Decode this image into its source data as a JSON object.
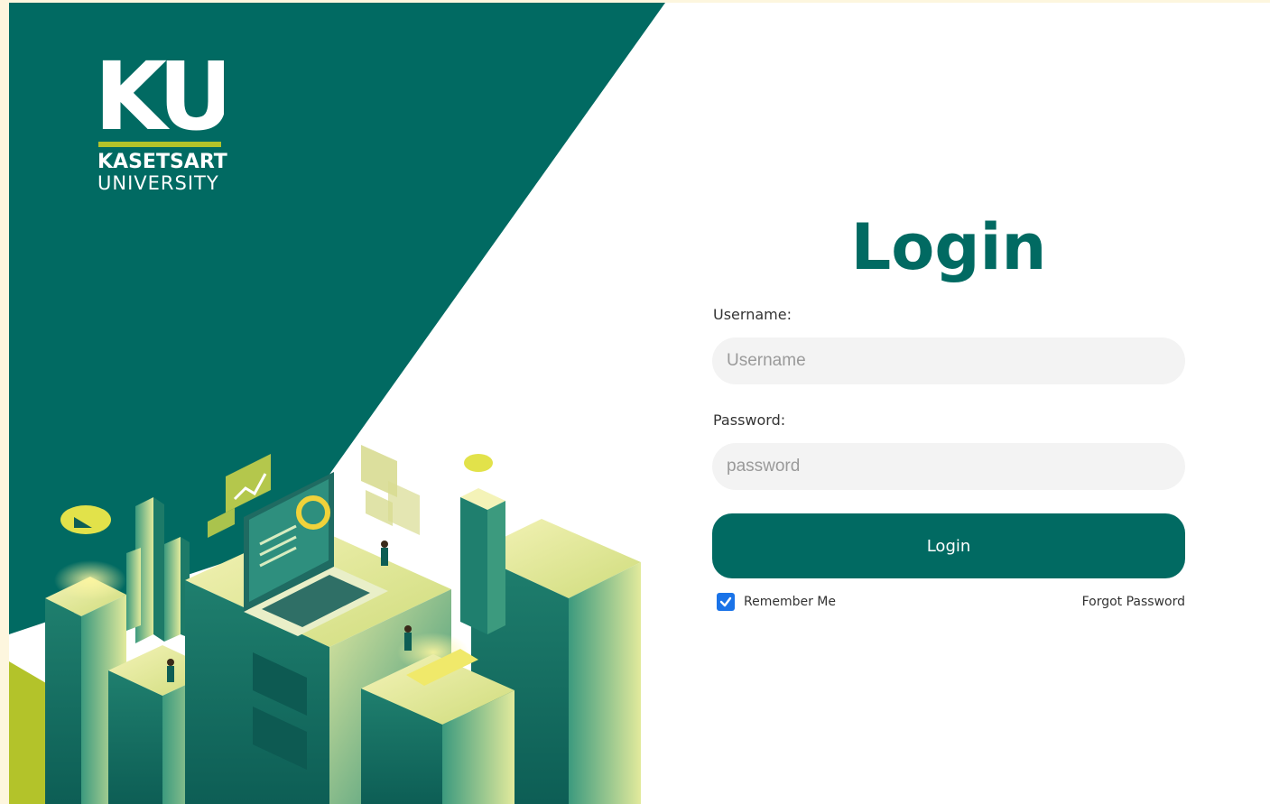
{
  "brand": {
    "logo_letters": "KU",
    "name": "KASETSART",
    "subtitle": "UNIVERSITY"
  },
  "form": {
    "title": "Login",
    "username_label": "Username:",
    "username_placeholder": "Username",
    "username_value": "",
    "password_label": "Password:",
    "password_placeholder": "password",
    "password_value": "",
    "submit_label": "Login",
    "remember_label": "Remember Me",
    "remember_checked": true,
    "forgot_label": "Forgot Password"
  },
  "colors": {
    "brand_teal": "#016a62",
    "brand_lime": "#b3c32a",
    "page_background": "#fdf6de",
    "input_background": "#f3f3f3",
    "checkbox_blue": "#1a73e8"
  },
  "icons": {
    "remember_checkbox": "check-icon",
    "illustration": "isometric-city-illustration"
  }
}
